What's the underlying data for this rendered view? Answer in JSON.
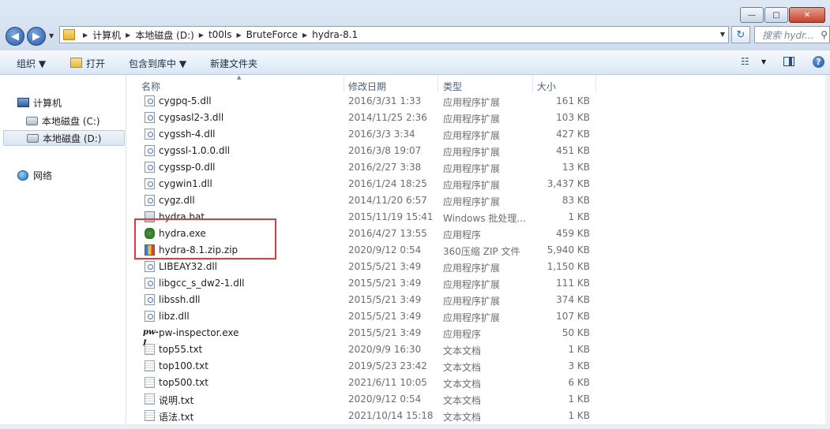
{
  "window": {
    "controls": {
      "minimize": "—",
      "maximize": "□",
      "close": "✕"
    }
  },
  "nav": {
    "back": "◀",
    "forward": "▶",
    "dropdown": "▼"
  },
  "address": {
    "crumbs": [
      "计算机",
      "本地磁盘 (D:)",
      "t00ls",
      "BruteForce",
      "hydra-8.1"
    ],
    "separator": "▶",
    "dropdown": "▼"
  },
  "refresh": "↻",
  "search": {
    "placeholder": "搜索 hydr...",
    "glyph": "⚲"
  },
  "toolbar": {
    "organize": "组织 ▼",
    "open": "打开",
    "include": "包含到库中 ▼",
    "new_folder": "新建文件夹",
    "view_glyph": "☷",
    "view_drop": "▼",
    "help": "?"
  },
  "sidebar": {
    "items": [
      {
        "label": "计算机"
      },
      {
        "label": "本地磁盘 (C:)"
      },
      {
        "label": "本地磁盘 (D:)"
      },
      {
        "label": "网络"
      }
    ]
  },
  "columns": {
    "name": "名称",
    "date": "修改日期",
    "type": "类型",
    "size": "大小",
    "sort_arrow": "▲"
  },
  "files": [
    {
      "name": "cygpq-5.dll",
      "date": "2016/3/31 1:33",
      "type": "应用程序扩展",
      "size": "161 KB",
      "icon": "dll"
    },
    {
      "name": "cygsasl2-3.dll",
      "date": "2014/11/25 2:36",
      "type": "应用程序扩展",
      "size": "103 KB",
      "icon": "dll"
    },
    {
      "name": "cygssh-4.dll",
      "date": "2016/3/3 3:34",
      "type": "应用程序扩展",
      "size": "427 KB",
      "icon": "dll"
    },
    {
      "name": "cygssl-1.0.0.dll",
      "date": "2016/3/8 19:07",
      "type": "应用程序扩展",
      "size": "451 KB",
      "icon": "dll"
    },
    {
      "name": "cygssp-0.dll",
      "date": "2016/2/27 3:38",
      "type": "应用程序扩展",
      "size": "13 KB",
      "icon": "dll"
    },
    {
      "name": "cygwin1.dll",
      "date": "2016/1/24 18:25",
      "type": "应用程序扩展",
      "size": "3,437 KB",
      "icon": "dll"
    },
    {
      "name": "cygz.dll",
      "date": "2014/11/20 6:57",
      "type": "应用程序扩展",
      "size": "83 KB",
      "icon": "dll"
    },
    {
      "name": "hydra.bat",
      "date": "2015/11/19 15:41",
      "type": "Windows 批处理...",
      "size": "1 KB",
      "icon": "bat"
    },
    {
      "name": "hydra.exe",
      "date": "2016/4/27 13:55",
      "type": "应用程序",
      "size": "459 KB",
      "icon": "exe"
    },
    {
      "name": "hydra-8.1.zip.zip",
      "date": "2020/9/12 0:54",
      "type": "360压缩 ZIP 文件",
      "size": "5,940 KB",
      "icon": "zip"
    },
    {
      "name": "LIBEAY32.dll",
      "date": "2015/5/21 3:49",
      "type": "应用程序扩展",
      "size": "1,150 KB",
      "icon": "dll"
    },
    {
      "name": "libgcc_s_dw2-1.dll",
      "date": "2015/5/21 3:49",
      "type": "应用程序扩展",
      "size": "111 KB",
      "icon": "dll"
    },
    {
      "name": "libssh.dll",
      "date": "2015/5/21 3:49",
      "type": "应用程序扩展",
      "size": "374 KB",
      "icon": "dll"
    },
    {
      "name": "libz.dll",
      "date": "2015/5/21 3:49",
      "type": "应用程序扩展",
      "size": "107 KB",
      "icon": "dll"
    },
    {
      "name": "pw-inspector.exe",
      "date": "2015/5/21 3:49",
      "type": "应用程序",
      "size": "50 KB",
      "icon": "pw",
      "icon_text": "pw-I"
    },
    {
      "name": "top55.txt",
      "date": "2020/9/9 16:30",
      "type": "文本文档",
      "size": "1 KB",
      "icon": "txt"
    },
    {
      "name": "top100.txt",
      "date": "2019/5/23 23:42",
      "type": "文本文档",
      "size": "3 KB",
      "icon": "txt"
    },
    {
      "name": "top500.txt",
      "date": "2021/6/11 10:05",
      "type": "文本文档",
      "size": "6 KB",
      "icon": "txt"
    },
    {
      "name": "说明.txt",
      "date": "2020/9/12 0:54",
      "type": "文本文档",
      "size": "1 KB",
      "icon": "txt"
    },
    {
      "name": "语法.txt",
      "date": "2021/10/14 15:18",
      "type": "文本文档",
      "size": "1 KB",
      "icon": "txt"
    }
  ],
  "colors": {
    "highlight": "#e03a3a",
    "accent": "#2b66c2"
  }
}
